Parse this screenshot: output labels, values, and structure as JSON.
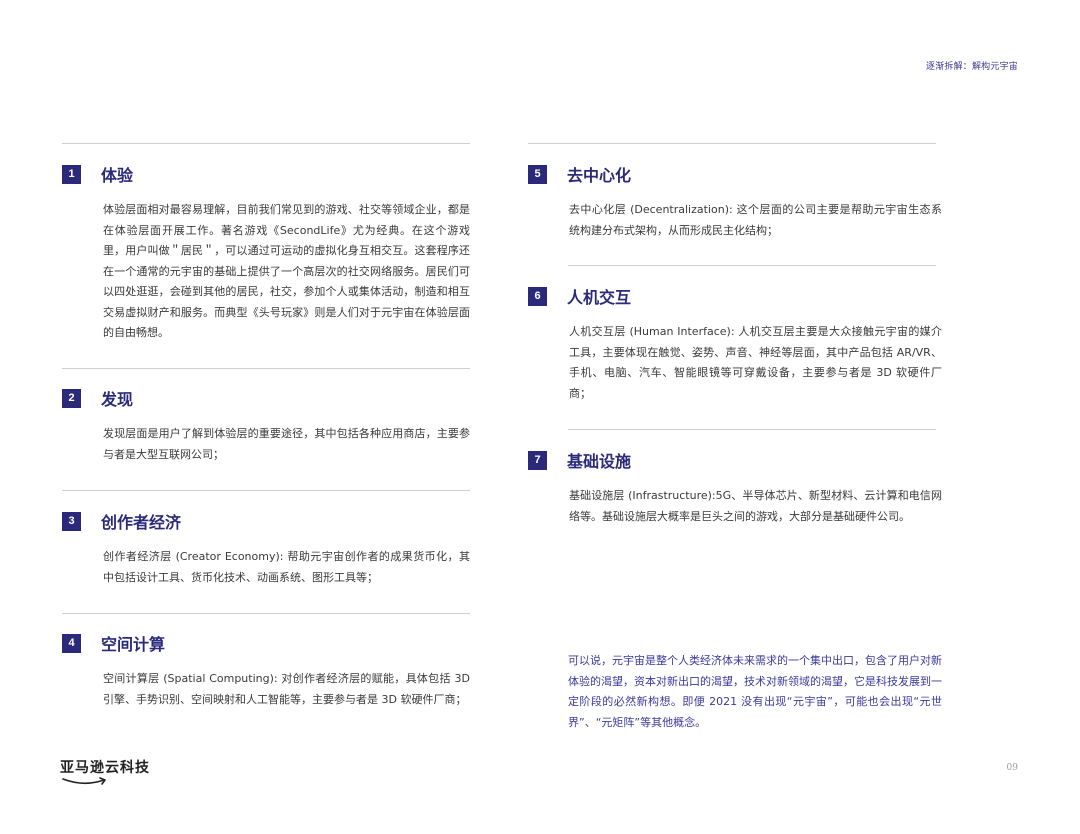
{
  "header": {
    "breadcrumb": "逐渐拆解：解构元宇宙"
  },
  "sections": [
    {
      "num": "1",
      "title": "体验",
      "body": "体验层面相对最容易理解，目前我们常见到的游戏、社交等领域企业，都是在体验层面开展工作。著名游戏《SecondLife》尤为经典。在这个游戏里，用户叫做＂居民＂，可以通过可运动的虚拟化身互相交互。这套程序还在一个通常的元宇宙的基础上提供了一个高层次的社交网络服务。居民们可以四处逛逛，会碰到其他的居民，社交，参加个人或集体活动，制造和相互交易虚拟财产和服务。而典型《头号玩家》则是人们对于元宇宙在体验层面的自由畅想。"
    },
    {
      "num": "2",
      "title": "发现",
      "body": "发现层面是用户了解到体验层的重要途径，其中包括各种应用商店，主要参与者是大型互联网公司；"
    },
    {
      "num": "3",
      "title": "创作者经济",
      "body": "创作者经济层 (Creator Economy): 帮助元宇宙创作者的成果货币化，其中包括设计工具、货币化技术、动画系统、图形工具等；"
    },
    {
      "num": "4",
      "title": "空间计算",
      "body": "空间计算层 (Spatial Computing): 对创作者经济层的赋能，具体包括 3D 引擎、手势识别、空间映射和人工智能等，主要参与者是 3D 软硬件厂商；"
    },
    {
      "num": "5",
      "title": "去中心化",
      "body": "去中心化层 (Decentralization): 这个层面的公司主要是帮助元宇宙生态系统构建分布式架构，从而形成民主化结构；"
    },
    {
      "num": "6",
      "title": "人机交互",
      "body": "人机交互层 (Human Interface): 人机交互层主要是大众接触元宇宙的媒介工具，主要体现在触觉、姿势、声音、神经等层面，其中产品包括 AR/VR、手机、电脑、汽车、智能眼镜等可穿戴设备，主要参与者是 3D 软硬件厂商；"
    },
    {
      "num": "7",
      "title": "基础设施",
      "body": "基础设施层 (Infrastructure):5G、半导体芯片、新型材料、云计算和电信网络等。基础设施层大概率是巨头之间的游戏，大部分是基础硬件公司。"
    }
  ],
  "closing": "可以说，元宇宙是整个人类经济体未来需求的一个集中出口，包含了用户对新体验的渴望，资本对新出口的渴望，技术对新领域的渴望，它是科技发展到一定阶段的必然新构想。即便 2021 没有出现“元宇宙”，可能也会出现“元世界”、“元矩阵”等其他概念。",
  "footer": {
    "logo_text": "亚马逊云科技",
    "page_number": "09"
  },
  "colors": {
    "accent": "#2b2a7a",
    "closing_text": "#3b3a9c",
    "divider": "#cfcfcf"
  }
}
